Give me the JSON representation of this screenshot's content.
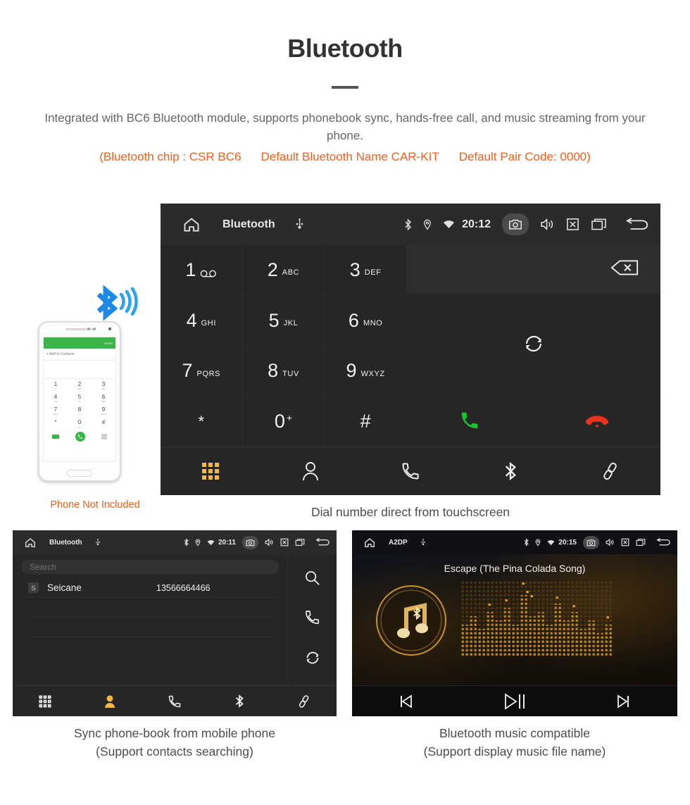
{
  "header": {
    "title": "Bluetooth",
    "subtitle": "Integrated with BC6 Bluetooth module, supports phonebook sync, hands-free call, and music streaming from your phone.",
    "accent_segments": [
      "(Bluetooth chip : CSR BC6",
      "Default Bluetooth Name CAR-KIT",
      "Default Pair Code: 0000)"
    ],
    "accent_color": "#f4601a"
  },
  "phone_mockup": {
    "header_back": "←",
    "header_more": "MORE",
    "add_to_contacts": "+   Add to Contacts",
    "keys": [
      {
        "num": "1",
        "sub": "∞"
      },
      {
        "num": "2",
        "sub": "ABC"
      },
      {
        "num": "3",
        "sub": "DEF"
      },
      {
        "num": "4",
        "sub": "GHI"
      },
      {
        "num": "5",
        "sub": "JKL"
      },
      {
        "num": "6",
        "sub": "MNO"
      },
      {
        "num": "7",
        "sub": "PQRS"
      },
      {
        "num": "8",
        "sub": "TUV"
      },
      {
        "num": "9",
        "sub": "WXYZ"
      },
      {
        "num": "*",
        "sub": ""
      },
      {
        "num": "0",
        "sub": "+"
      },
      {
        "num": "#",
        "sub": ""
      }
    ],
    "not_included_label": "Phone Not Included"
  },
  "dialer": {
    "statusbar": {
      "home_icon": "home-icon",
      "title": "Bluetooth",
      "usb_icon": "usb-icon",
      "bluetooth_icon": "bluetooth-icon",
      "location_icon": "location-icon",
      "wifi_icon": "wifi-icon",
      "time": "20:12",
      "camera_icon": "camera-icon",
      "volume_icon": "volume-icon",
      "close_icon": "close-box-icon",
      "recents_icon": "recents-icon",
      "back_icon": "back-icon"
    },
    "keys": [
      {
        "num": "1",
        "sub": "",
        "voicemail": true
      },
      {
        "num": "2",
        "sub": "ABC"
      },
      {
        "num": "3",
        "sub": "DEF"
      },
      {
        "num": "4",
        "sub": "GHI"
      },
      {
        "num": "5",
        "sub": "JKL"
      },
      {
        "num": "6",
        "sub": "MNO"
      },
      {
        "num": "7",
        "sub": "PQRS"
      },
      {
        "num": "8",
        "sub": "TUV"
      },
      {
        "num": "9",
        "sub": "WXYZ"
      },
      {
        "num": "*",
        "sub": ""
      },
      {
        "num": "0",
        "sup": "+"
      },
      {
        "num": "#",
        "sub": ""
      }
    ],
    "input_value": "",
    "backspace_icon": "backspace-icon",
    "sync_icon": "sync-icon",
    "call_icon": "call-icon",
    "hangup_icon": "hangup-icon",
    "call_color": "#17c429",
    "hangup_color": "#e8341c",
    "navbar": [
      {
        "name": "keypad",
        "icon": "keypad-icon",
        "active": true
      },
      {
        "name": "contacts",
        "icon": "contact-icon",
        "active": false
      },
      {
        "name": "call-log",
        "icon": "phone-icon",
        "active": false
      },
      {
        "name": "bluetooth",
        "icon": "bluetooth-icon",
        "active": false
      },
      {
        "name": "link",
        "icon": "link-icon",
        "active": false
      }
    ],
    "active_color": "#f5b942",
    "caption": "Dial number direct from touchscreen"
  },
  "phonebook": {
    "statusbar": {
      "title": "Bluetooth",
      "time": "20:11"
    },
    "search_placeholder": "Search",
    "columns": [
      "name",
      "number"
    ],
    "contacts": [
      {
        "initial": "S",
        "name": "Seicane",
        "number": "13566664466"
      }
    ],
    "side_actions": [
      {
        "name": "search",
        "icon": "search-icon"
      },
      {
        "name": "dial",
        "icon": "phone-icon"
      },
      {
        "name": "sync",
        "icon": "sync-icon"
      }
    ],
    "navbar": [
      {
        "name": "keypad",
        "icon": "keypad-icon",
        "active": false
      },
      {
        "name": "contacts",
        "icon": "contact-icon",
        "active": true
      },
      {
        "name": "call-log",
        "icon": "phone-icon",
        "active": false
      },
      {
        "name": "bluetooth",
        "icon": "bluetooth-icon",
        "active": false
      },
      {
        "name": "link",
        "icon": "link-icon",
        "active": false
      }
    ],
    "caption_line1": "Sync phone-book from mobile phone",
    "caption_line2": "(Support contacts searching)"
  },
  "music": {
    "statusbar": {
      "title": "A2DP",
      "time": "20:15"
    },
    "track_title": "Escape (The Pina Colada Song)",
    "controls": [
      {
        "name": "previous",
        "icon": "previous-track-icon"
      },
      {
        "name": "play-pause",
        "icon": "play-pause-icon"
      },
      {
        "name": "next",
        "icon": "next-track-icon"
      }
    ],
    "accent_color": "#d8a23a",
    "caption_line1": "Bluetooth music compatible",
    "caption_line2": "(Support display music file name)"
  }
}
